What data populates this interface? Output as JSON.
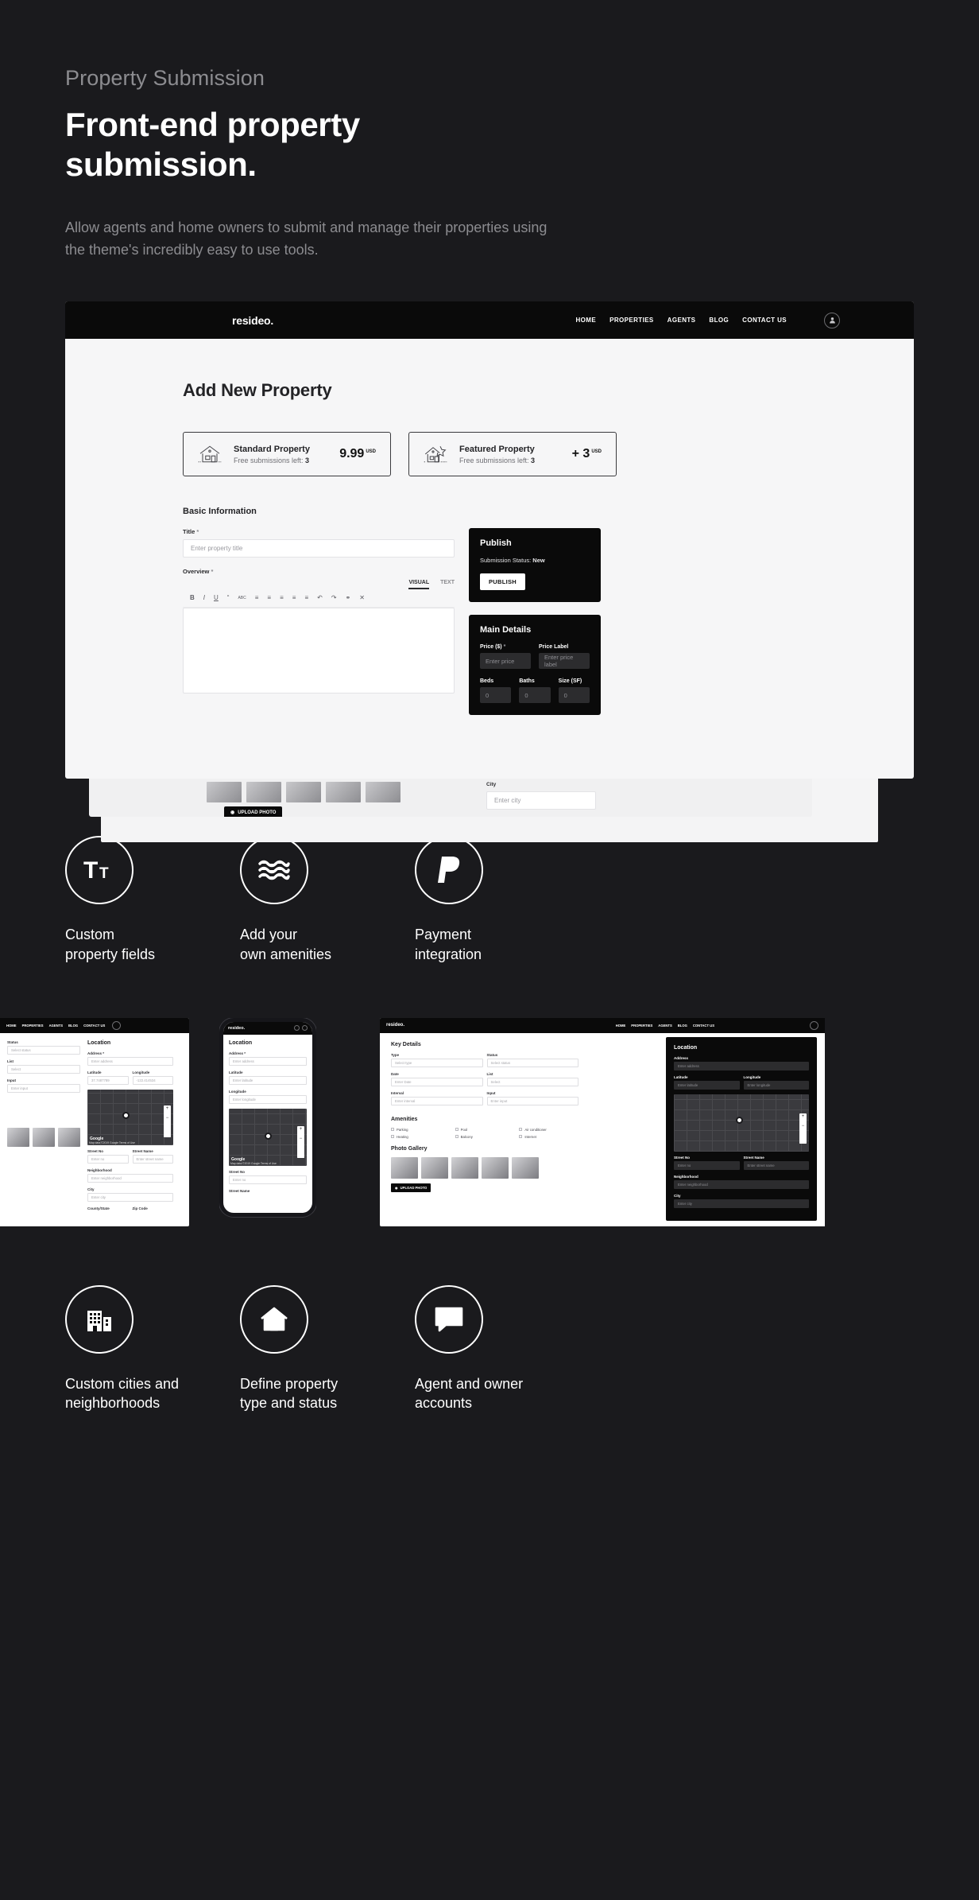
{
  "hero": {
    "eyebrow": "Property Submission",
    "title": "Front-end property submission.",
    "subtitle": "Allow agents and home owners to submit and manage their properties using the theme's incredibly easy to use tools."
  },
  "mockup": {
    "nav": {
      "logo": "resideo.",
      "menu": [
        "HOME",
        "PROPERTIES",
        "AGENTS",
        "BLOG",
        "CONTACT US"
      ],
      "account_icon": "user-icon"
    },
    "page_title": "Add New Property",
    "plans": [
      {
        "name": "Standard Property",
        "sub_prefix": "Free submissions left: ",
        "sub_value": "3",
        "price": "9.99",
        "currency": "USD",
        "icon": "house-icon"
      },
      {
        "name": "Featured Property",
        "sub_prefix": "Free submissions left: ",
        "sub_value": "3",
        "price": "+ 3",
        "currency": "USD",
        "icon": "house-star-icon"
      }
    ],
    "basic_information": {
      "section_title": "Basic Information",
      "title_label": "Title",
      "title_required": "*",
      "title_placeholder": "Enter property title",
      "overview_label": "Overview",
      "overview_required": "*",
      "tab_visual": "VISUAL",
      "tab_text": "TEXT",
      "toolbar": [
        "B",
        "I",
        "U",
        "“",
        "ABC",
        "≡",
        "≡",
        "≡",
        "≡",
        "≡",
        "↶",
        "↷",
        "⚭",
        "✕"
      ]
    },
    "publish_panel": {
      "title": "Publish",
      "status_label": "Submission Status:",
      "status_value": "New",
      "button": "PUBLISH"
    },
    "main_details_panel": {
      "title": "Main Details",
      "price_label": "Price ($)",
      "price_required": "*",
      "price_placeholder": "Enter price",
      "price_label_label": "Price Label",
      "price_label_placeholder": "Enter price label",
      "beds_label": "Beds",
      "beds_placeholder": "0",
      "baths_label": "Baths",
      "baths_placeholder": "0",
      "size_label": "Size (SF)",
      "size_placeholder": "0"
    },
    "strip": {
      "upload_button": "UPLOAD PHOTO",
      "upload_icon": "camera-icon",
      "city_label": "City",
      "city_placeholder": "Enter city"
    }
  },
  "features_top": [
    {
      "icon": "typography-icon",
      "label": "Custom\nproperty fields"
    },
    {
      "icon": "waves-icon",
      "label": "Add your\nown amenities"
    },
    {
      "icon": "paypal-icon",
      "label": "Payment\nintegration"
    }
  ],
  "features_bottom": [
    {
      "icon": "buildings-icon",
      "label": "Custom cities and\nneighborhoods"
    },
    {
      "icon": "home-icon",
      "label": "Define property\ntype and status"
    },
    {
      "icon": "contact-card-icon",
      "label": "Agent and owner\naccounts"
    }
  ],
  "shots": {
    "left": {
      "nav": {
        "menu": [
          "HOME",
          "PROPERTIES",
          "AGENTS",
          "BLOG",
          "CONTACT US"
        ]
      },
      "fields": [
        {
          "label": "Status",
          "placeholder": "Select status"
        },
        {
          "label": "List",
          "placeholder": "Select"
        },
        {
          "label": "Input",
          "placeholder": "Enter input"
        }
      ],
      "location": {
        "title": "Location",
        "address_label": "Address",
        "address_required": "*",
        "address_placeholder": "Enter address",
        "latitude_label": "Latitude",
        "latitude_value": "37.7487789",
        "longitude_label": "Longitude",
        "longitude_value": "-122.414534",
        "street_no_label": "Street No",
        "street_no_placeholder": "Enter no",
        "street_name_label": "Street Name",
        "street_name_placeholder": "Enter street name",
        "neighborhood_label": "Neighborhood",
        "neighborhood_placeholder": "Enter neighborhood",
        "city_label": "City",
        "city_placeholder": "Enter city",
        "county_label": "County/State",
        "zip_label": "Zip Code",
        "map_attribution": "Map data ©2019 Google  Terms of Use",
        "map_brand": "Google",
        "zoom_in": "+",
        "zoom_out": "−"
      }
    },
    "phone": {
      "logo": "resideo.",
      "location_title": "Location",
      "address_label": "Address",
      "address_required": "*",
      "address_placeholder": "Enter address",
      "latitude_label": "Latitude",
      "latitude_placeholder": "Enter latitude",
      "longitude_label": "Longitude",
      "longitude_placeholder": "Enter longitude",
      "street_no_label": "Street No",
      "street_no_placeholder": "Enter no",
      "street_name_label": "Street Name",
      "map_brand": "Google",
      "map_attribution": "Map data ©2019 Google  Terms of Use",
      "zoom_in": "+",
      "zoom_out": "−"
    },
    "right": {
      "nav": {
        "logo": "resideo.",
        "menu": [
          "HOME",
          "PROPERTIES",
          "AGENTS",
          "BLOG",
          "CONTACT US"
        ]
      },
      "key_details_title": "Key Details",
      "key_details": [
        {
          "label": "Type",
          "placeholder": "Select type"
        },
        {
          "label": "Status",
          "placeholder": "Select status"
        },
        {
          "label": "Date",
          "placeholder": "Enter Date"
        },
        {
          "label": "List",
          "placeholder": "Select"
        },
        {
          "label": "Interval",
          "placeholder": "Enter interval"
        },
        {
          "label": "Input",
          "placeholder": "Enter input"
        }
      ],
      "amenities_title": "Amenities",
      "amenities": [
        "Parking",
        "Pool",
        "Air conditioner",
        "Heating",
        "Balcony",
        "Internet"
      ],
      "gallery_title": "Photo Gallery",
      "upload_button": "UPLOAD PHOTO",
      "location": {
        "title": "Location",
        "address_label": "Address",
        "address_placeholder": "Enter address",
        "latitude_label": "Latitude",
        "latitude_placeholder": "Enter latitude",
        "longitude_label": "Longitude",
        "longitude_placeholder": "Enter longitude",
        "street_no_label": "Street No",
        "street_no_placeholder": "Enter no",
        "street_name_label": "Street Name",
        "street_name_placeholder": "Enter street name",
        "neighborhood_label": "Neighborhood",
        "neighborhood_placeholder": "Enter neighborhood",
        "city_label": "City",
        "city_placeholder": "Enter city",
        "zoom_in": "+",
        "zoom_out": "−"
      }
    }
  },
  "colors": {
    "background": "#1a1a1d",
    "panel_dark": "#0a0a0a",
    "surface": "#f6f6f7",
    "accent": "#ffffff"
  }
}
